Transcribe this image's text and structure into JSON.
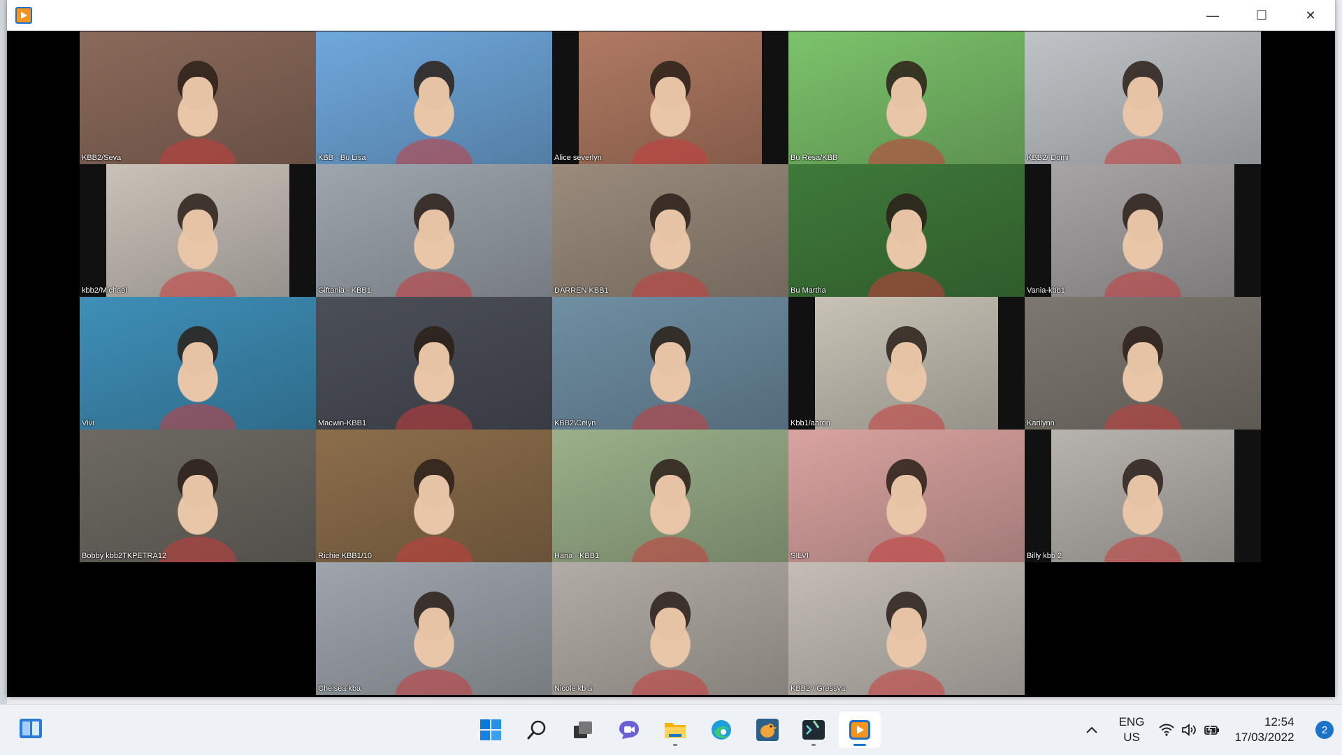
{
  "window": {
    "minimize_glyph": "—",
    "maximize_glyph": "☐",
    "close_glyph": "✕"
  },
  "participants": [
    {
      "name": "KBB2/Seva",
      "bg": "#8a6a5a"
    },
    {
      "name": "KBB - Bu Lisa",
      "bg": "#6fa8dc"
    },
    {
      "name": "Alice severlyn",
      "bg": "#b07a62"
    },
    {
      "name": "Bu Resa/KBB",
      "bg": "#7cc36b"
    },
    {
      "name": "KBB2/ Domi",
      "bg": "#bfc3c7"
    },
    {
      "name": "kbb2/Michael",
      "bg": "#c9c2b9"
    },
    {
      "name": "Giftania - KBB1",
      "bg": "#9da6ad"
    },
    {
      "name": "DARREN KBB1",
      "bg": "#9a8b7c"
    },
    {
      "name": "Bu Martha",
      "bg": "#3f7a3a"
    },
    {
      "name": "Vania-kbb1",
      "bg": "#a8a4a6"
    },
    {
      "name": "Vivi",
      "bg": "#3e8fb8"
    },
    {
      "name": "Macwin-KBB1",
      "bg": "#4b4f57"
    },
    {
      "name": "KBB2\\Celyn",
      "bg": "#6f8fa3"
    },
    {
      "name": "Kbb1/aaron",
      "bg": "#c8c2b6"
    },
    {
      "name": "Karilynn",
      "bg": "#7d786f"
    },
    {
      "name": "Bobby kbb2TKPETRA12",
      "bg": "#6e6a63"
    },
    {
      "name": "Richie KBB1/10",
      "bg": "#8c6e4b"
    },
    {
      "name": "Hana - KBB1",
      "bg": "#9bb08a"
    },
    {
      "name": "SILVI",
      "bg": "#d9a3a0"
    },
    {
      "name": "Billy kbb 2",
      "bg": "#b7b3ad"
    },
    {
      "name": "",
      "bg": "#000000"
    },
    {
      "name": "Chelsea kba",
      "bg": "#9ea5ab"
    },
    {
      "name": "Nicole kb a",
      "bg": "#b2aca4"
    },
    {
      "name": "KBB2 / Gressya",
      "bg": "#c4bdb6"
    },
    {
      "name": "",
      "bg": "#000000"
    }
  ],
  "taskbar": {
    "lang_line1": "ENG",
    "lang_line2": "US",
    "time": "12:54",
    "date": "17/03/2022",
    "notification_count": "2",
    "apps": [
      "start",
      "search",
      "task-view",
      "chat",
      "file-explorer",
      "edge",
      "duo",
      "terminal",
      "media-player"
    ]
  }
}
